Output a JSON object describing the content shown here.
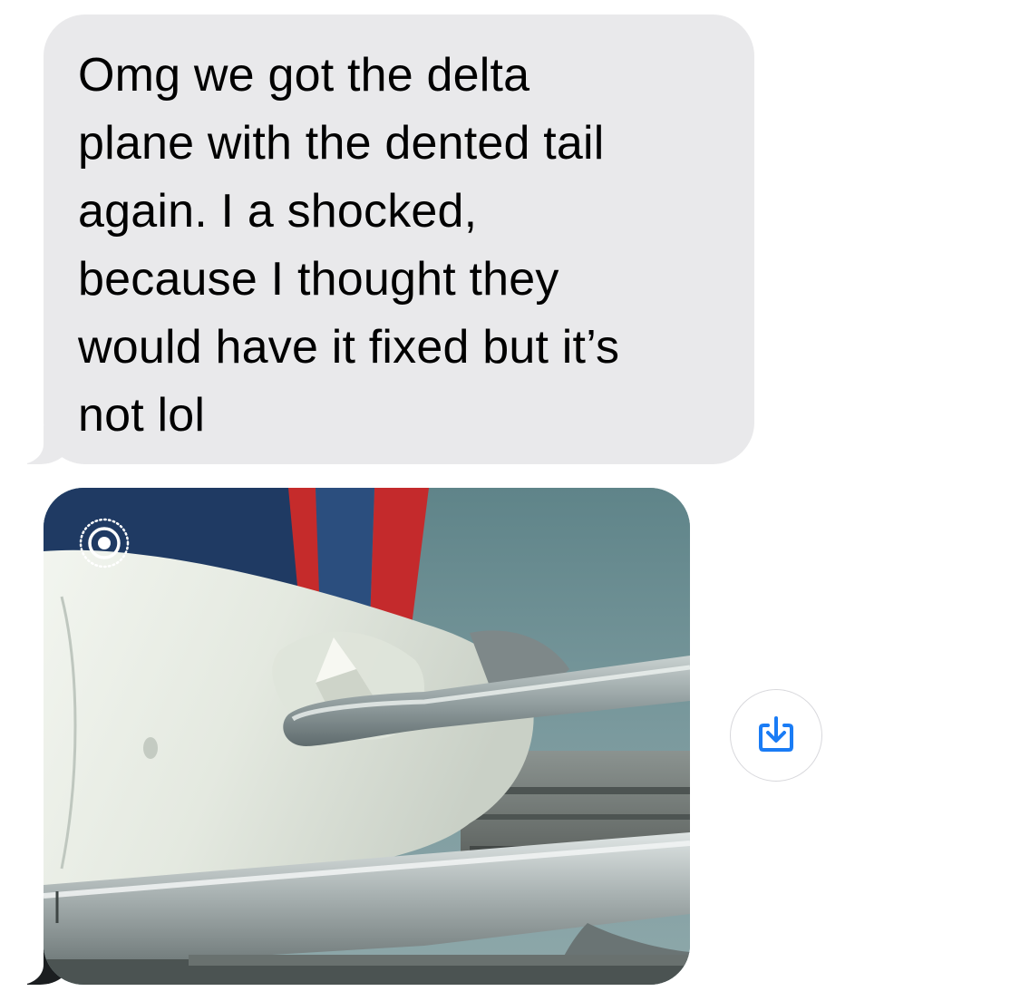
{
  "conversation": {
    "messages": [
      {
        "type": "text",
        "direction": "incoming",
        "text": "Omg we got the delta\nplane with the dented tail\nagain. I a shocked,\nbecause I thought they\nwould have it fixed but it’s\nnot lol"
      },
      {
        "type": "photo",
        "direction": "incoming",
        "badge_icon": "live-photo-icon",
        "action_icon": "save-to-photos-icon"
      }
    ]
  },
  "colors": {
    "incoming_bubble": "#e9e9eb",
    "accent_blue": "#1a7cf5",
    "button_border": "#d8d8dc"
  }
}
